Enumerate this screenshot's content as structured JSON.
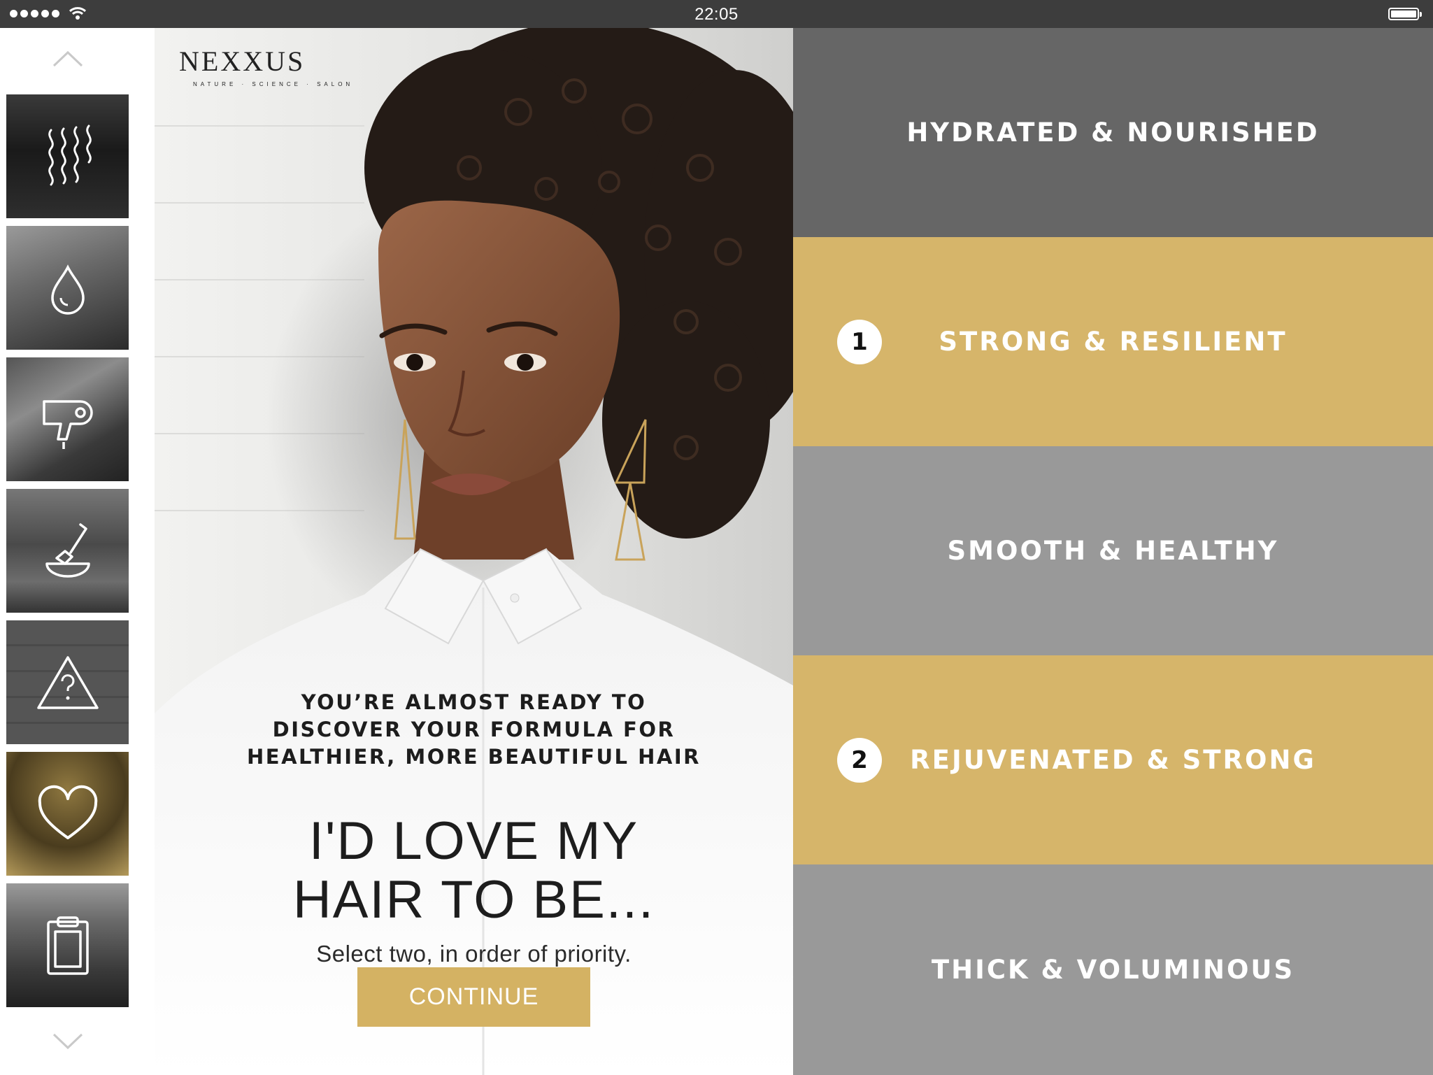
{
  "status_bar": {
    "time": "22:05",
    "icons": [
      "signal-dots-icon",
      "wifi-icon",
      "battery-icon"
    ]
  },
  "sidebar": {
    "scroll_up_icon": "chevron-up-icon",
    "scroll_down_icon": "chevron-down-icon",
    "items": [
      {
        "icon": "hair-waves-icon",
        "selected": false
      },
      {
        "icon": "water-drop-icon",
        "selected": false
      },
      {
        "icon": "hair-dryer-icon",
        "selected": false
      },
      {
        "icon": "brush-bowl-icon",
        "selected": false
      },
      {
        "icon": "warning-question-icon",
        "selected": false
      },
      {
        "icon": "heart-icon",
        "selected": true
      },
      {
        "icon": "clipboard-icon",
        "selected": false
      }
    ]
  },
  "hero": {
    "logo": {
      "wordmark": "NEXXUS",
      "tagline": "NATURE · SCIENCE · SALON"
    },
    "intro_lines": [
      "YOU’RE ALMOST READY TO",
      "DISCOVER YOUR FORMULA FOR",
      "HEALTHIER, MORE BEAUTIFUL HAIR"
    ],
    "headline_lines": [
      "I'D LOVE MY",
      "HAIR TO BE..."
    ],
    "subtitle": "Select two, in order of priority.",
    "continue_label": "CONTINUE"
  },
  "options": [
    {
      "label": "HYDRATED & NOURISHED",
      "rank": "",
      "color": "#666666"
    },
    {
      "label": "STRONG & RESILIENT",
      "rank": "1",
      "color": "#d6b56a"
    },
    {
      "label": "SMOOTH & HEALTHY",
      "rank": "",
      "color": "#999999"
    },
    {
      "label": "REJUVENATED & STRONG",
      "rank": "2",
      "color": "#d6b56a"
    },
    {
      "label": "THICK & VOLUMINOUS",
      "rank": "",
      "color": "#999999"
    }
  ],
  "colors": {
    "accent_gold": "#d4b263",
    "status_bar": "#3d3d3d",
    "option_dark": "#666666",
    "option_light": "#999999"
  }
}
